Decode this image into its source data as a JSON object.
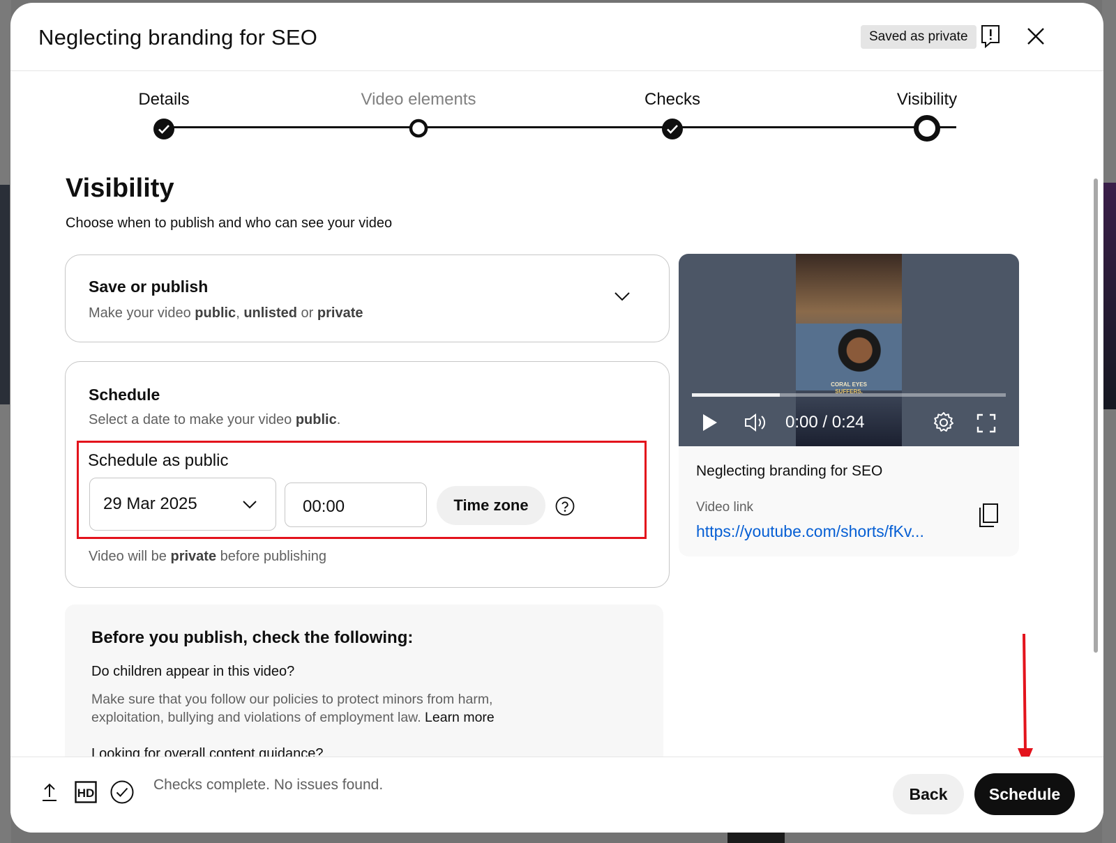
{
  "dialog": {
    "title": "Neglecting branding for SEO",
    "saved_status": "Saved as private"
  },
  "steps": [
    {
      "label": "Details",
      "state": "done"
    },
    {
      "label": "Video elements",
      "state": "visited"
    },
    {
      "label": "Checks",
      "state": "done"
    },
    {
      "label": "Visibility",
      "state": "current"
    }
  ],
  "visibility": {
    "heading": "Visibility",
    "subheading": "Choose when to publish and who can see your video"
  },
  "save_publish": {
    "title": "Save or publish",
    "sub_prefix": "Make your video ",
    "opt_public": "public",
    "sep1": ", ",
    "opt_unlisted": "unlisted",
    "sep2": " or ",
    "opt_private": "private"
  },
  "schedule": {
    "title": "Schedule",
    "sub_prefix": "Select a date to make your video ",
    "sub_bold": "public",
    "sub_suffix": ".",
    "label": "Schedule as public",
    "date": "29 Mar 2025",
    "time": "00:00",
    "timezone_label": "Time zone",
    "note_prefix": "Video will be ",
    "note_bold": "private",
    "note_suffix": " before publishing"
  },
  "checklist": {
    "heading": "Before you publish, check the following:",
    "q1": "Do children appear in this video?",
    "q1_body": "Make sure that you follow our policies to protect minors from harm, exploitation, bullying and violations of employment law.",
    "learn_more": "Learn more",
    "q2": "Looking for overall content guidance?"
  },
  "preview": {
    "caption_line1": "CORAL EYES",
    "caption_line2": "SUFFERS.",
    "time_display": "0:00 / 0:24",
    "progress": 0.28,
    "title": "Neglecting branding for SEO",
    "link_label": "Video link",
    "link": "https://youtube.com/shorts/fKv..."
  },
  "footer": {
    "status": "Checks complete. No issues found.",
    "back_label": "Back",
    "schedule_label": "Schedule"
  },
  "colors": {
    "highlight": "#e3131c",
    "link": "#065fd4",
    "primary": "#0f0f0f"
  }
}
